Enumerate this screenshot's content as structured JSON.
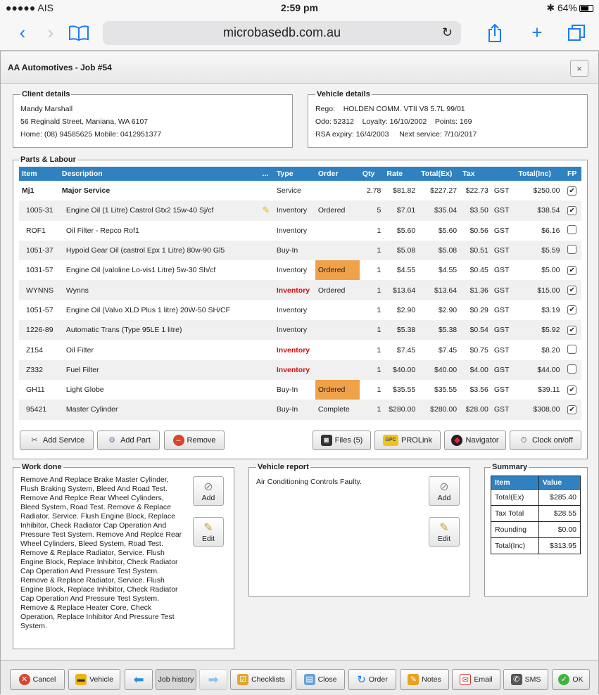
{
  "status": {
    "carrier": "●●●●● AIS",
    "time": "2:59 pm",
    "battery": "64%"
  },
  "browser": {
    "url": "microbasedb.com.au"
  },
  "window": {
    "title": "AA Automotives - Job #54",
    "close": "×"
  },
  "client": {
    "legend": "Client details",
    "name": "Mandy Marshall",
    "address": "56 Reginald Street, Maniana, WA 6107",
    "phones": "Home: (08) 94585625 Mobile: 0412951377"
  },
  "vehicle": {
    "legend": "Vehicle details",
    "rego_label": "Rego:",
    "rego": "HOLDEN COMM. VTII V8 5.7L 99/01",
    "odo": "Odo: 52312",
    "loyalty": "Loyalty: 16/10/2002",
    "points": "Points: 169",
    "rsa": "RSA expiry: 16/4/2003",
    "next_service": "Next service: 7/10/2017"
  },
  "parts": {
    "legend": "Parts & Labour",
    "columns": [
      "Item",
      "Description",
      "...",
      "Type",
      "Order",
      "Qty",
      "Rate",
      "Total(Ex)",
      "Tax",
      "",
      "Total(Inc)",
      "FP"
    ],
    "rows": [
      {
        "item": "Mj1",
        "desc": "Major Service",
        "note": false,
        "type": "Service",
        "type_red": false,
        "order": "",
        "qty": "2.78",
        "rate": "$81.82",
        "totex": "$227.27",
        "tax": "$22.73",
        "code": "GST",
        "totinc": "$250.00",
        "fp": true,
        "bold": true
      },
      {
        "item": "1005-31",
        "desc": "Engine Oil (1 Litre) Castrol Gtx2 15w-40 Sj/cf",
        "note": true,
        "type": "Inventory",
        "type_red": false,
        "order": "Ordered",
        "qty": "5",
        "rate": "$7.01",
        "totex": "$35.04",
        "tax": "$3.50",
        "code": "GST",
        "totinc": "$38.54",
        "fp": true,
        "bold": false
      },
      {
        "item": "ROF1",
        "desc": "Oil Filter - Repco Rof1",
        "note": false,
        "type": "Inventory",
        "type_red": false,
        "order": "",
        "qty": "1",
        "rate": "$5.60",
        "totex": "$5.60",
        "tax": "$0.56",
        "code": "GST",
        "totinc": "$6.16",
        "fp": false,
        "bold": false
      },
      {
        "item": "1051-37",
        "desc": "Hypoid Gear Oil (castrol Epx 1 Litre) 80w-90 Gl5",
        "note": false,
        "type": "Buy-In",
        "type_red": false,
        "order": "",
        "qty": "1",
        "rate": "$5.08",
        "totex": "$5.08",
        "tax": "$0.51",
        "code": "GST",
        "totinc": "$5.59",
        "fp": false,
        "bold": false
      },
      {
        "item": "1031-57",
        "desc": "Engine Oil (valoline Lo-vis1 Litre) 5w-30 Sh/cf",
        "note": false,
        "type": "Inventory",
        "type_red": false,
        "order": "Ordered",
        "qty": "1",
        "rate": "$4.55",
        "totex": "$4.55",
        "tax": "$0.45",
        "code": "GST",
        "totinc": "$5.00",
        "fp": true,
        "bold": false
      },
      {
        "item": "WYNNS",
        "desc": "Wynns",
        "note": false,
        "type": "Inventory",
        "type_red": true,
        "order": "Ordered",
        "qty": "1",
        "rate": "$13.64",
        "totex": "$13.64",
        "tax": "$1.36",
        "code": "GST",
        "totinc": "$15.00",
        "fp": true,
        "bold": false
      },
      {
        "item": "1051-57",
        "desc": "Engine Oil (Valvo XLD Plus 1 litre) 20W-50 SH/CF",
        "note": false,
        "type": "Inventory",
        "type_red": false,
        "order": "",
        "qty": "1",
        "rate": "$2.90",
        "totex": "$2.90",
        "tax": "$0.29",
        "code": "GST",
        "totinc": "$3.19",
        "fp": true,
        "bold": false
      },
      {
        "item": "1226-89",
        "desc": "Automatic Trans (Type 95LE 1 litre)",
        "note": false,
        "type": "Inventory",
        "type_red": false,
        "order": "",
        "qty": "1",
        "rate": "$5.38",
        "totex": "$5.38",
        "tax": "$0.54",
        "code": "GST",
        "totinc": "$5.92",
        "fp": true,
        "bold": false
      },
      {
        "item": "Z154",
        "desc": "Oil Filter",
        "note": false,
        "type": "Inventory",
        "type_red": true,
        "order": "",
        "qty": "1",
        "rate": "$7.45",
        "totex": "$7.45",
        "tax": "$0.75",
        "code": "GST",
        "totinc": "$8.20",
        "fp": false,
        "bold": false
      },
      {
        "item": "Z332",
        "desc": "Fuel Filter",
        "note": false,
        "type": "Inventory",
        "type_red": true,
        "order": "",
        "qty": "1",
        "rate": "$40.00",
        "totex": "$40.00",
        "tax": "$4.00",
        "code": "GST",
        "totinc": "$44.00",
        "fp": false,
        "bold": false
      },
      {
        "item": "GH11",
        "desc": "Light Globe",
        "note": false,
        "type": "Buy-In",
        "type_red": false,
        "order": "Ordered",
        "qty": "1",
        "rate": "$35.55",
        "totex": "$35.55",
        "tax": "$3.56",
        "code": "GST",
        "totinc": "$39.11",
        "fp": true,
        "bold": false
      },
      {
        "item": "95421",
        "desc": "Master Cylinder",
        "note": false,
        "type": "Buy-In",
        "type_red": false,
        "order": "Complete",
        "qty": "1",
        "rate": "$280.00",
        "totex": "$280.00",
        "tax": "$28.00",
        "code": "GST",
        "totinc": "$308.00",
        "fp": true,
        "bold": false
      }
    ],
    "buttons": {
      "add_service": "Add Service",
      "add_part": "Add Part",
      "remove": "Remove",
      "files": "Files (5)",
      "prolink": "PROLink",
      "navigator": "Navigator",
      "clock": "Clock on/off"
    }
  },
  "work_done": {
    "legend": "Work done",
    "text": "Remove And Replace Brake Master Cylinder, Flush Braking System, Bleed And Road Test. Remove And Replce Rear Wheel Cylinders, Bleed System, Road Test. Remove & Replace Radiator, Service. Flush Engine Block, Replace Inhibitor, Check Radiator Cap Operation And Pressure Test System. Remove And Replce Rear Wheel Cylinders, Bleed System, Road Test. Remove & Replace Radiator, Service. Flush Engine Block, Replace Inhibitor, Check Radiator Cap Operation And Pressure Test System. Remove & Replace Radiator, Service. Flush Engine Block, Replace Inhibitor, Check Radiator Cap Operation And Pressure Test System. Remove & Replace Heater Core, Check Operation, Replace Inhibitor And Pressure Test System.",
    "add": "Add",
    "edit": "Edit"
  },
  "vehicle_report": {
    "legend": "Vehicle report",
    "text": "Air Conditioning Controls Faulty.",
    "add": "Add",
    "edit": "Edit"
  },
  "summary": {
    "legend": "Summary",
    "head_item": "Item",
    "head_value": "Value",
    "rows": [
      {
        "item": "Total(Ex)",
        "value": "$285.40"
      },
      {
        "item": "Tax Total",
        "value": "$28.55"
      },
      {
        "item": "Rounding",
        "value": "$0.00"
      },
      {
        "item": "Total(Inc)",
        "value": "$313.95"
      }
    ]
  },
  "bottom": {
    "cancel": "Cancel",
    "vehicle": "Vehicle",
    "job_history": "Job history",
    "checklists": "Checklists",
    "close": "Close",
    "order": "Order",
    "notes": "Notes",
    "email": "Email",
    "sms": "SMS",
    "ok": "OK"
  },
  "colors": {
    "header_blue": "#2f81bf",
    "ordered": "#f0a24a",
    "complete": "#49e74b",
    "alert_red": "#d31010"
  }
}
